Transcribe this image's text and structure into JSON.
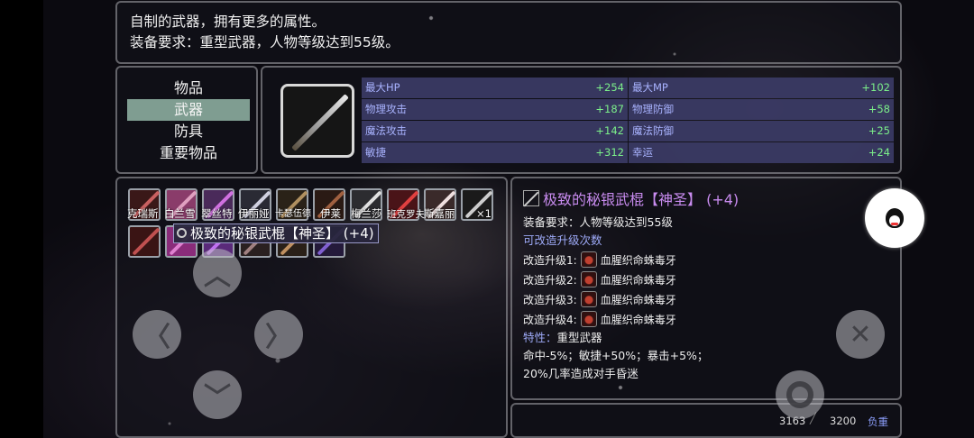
{
  "description": {
    "line1": "自制的武器，拥有更多的属性。",
    "line2": "装备要求：重型武器，人物等级达到55级。"
  },
  "categories": [
    "物品",
    "武器",
    "防具",
    "重要物品"
  ],
  "active_category": "武器",
  "stats": [
    {
      "label": "最大HP",
      "value": "+254"
    },
    {
      "label": "最大MP",
      "value": "+102"
    },
    {
      "label": "物理攻击",
      "value": "+187"
    },
    {
      "label": "物理防御",
      "value": "+58"
    },
    {
      "label": "魔法攻击",
      "value": "+142"
    },
    {
      "label": "魔法防御",
      "value": "+25"
    },
    {
      "label": "敏捷",
      "value": "+312"
    },
    {
      "label": "幸运",
      "value": "+24"
    }
  ],
  "inventory_names": [
    "克瑞斯",
    "白兰雪",
    "翠丝特",
    "伊丽娅",
    "卡瑟伍德",
    "伊莱",
    "梅兰莎",
    "班克罗夫",
    "斯嘉丽",
    "×1"
  ],
  "tooltip": "极致的秘银武棍【神圣】 (+4)",
  "detail": {
    "title": "极致的秘银武棍【神圣】 (+4)",
    "requirement": "装备要求：人物等级达到55级",
    "upgradable": "可改造升级次数",
    "upgrades": [
      {
        "label": "改造升级1:",
        "item": "血腥织命蛛毒牙"
      },
      {
        "label": "改造升级2:",
        "item": "血腥织命蛛毒牙"
      },
      {
        "label": "改造升级3:",
        "item": "血腥织命蛛毒牙"
      },
      {
        "label": "改造升级4:",
        "item": "血腥织命蛛毒牙"
      }
    ],
    "trait_label": "特性：",
    "trait_value": "重型武器",
    "effects1": "命中-5%；敏捷+50%；暴击+5%；",
    "effects2": "20%几率造成对手昏迷"
  },
  "weight": {
    "current": "3163",
    "max": "3200",
    "label": "负重"
  },
  "controls": {
    "up": "︿",
    "down": "﹀",
    "left": "〈",
    "right": "〉",
    "close": "✕"
  }
}
